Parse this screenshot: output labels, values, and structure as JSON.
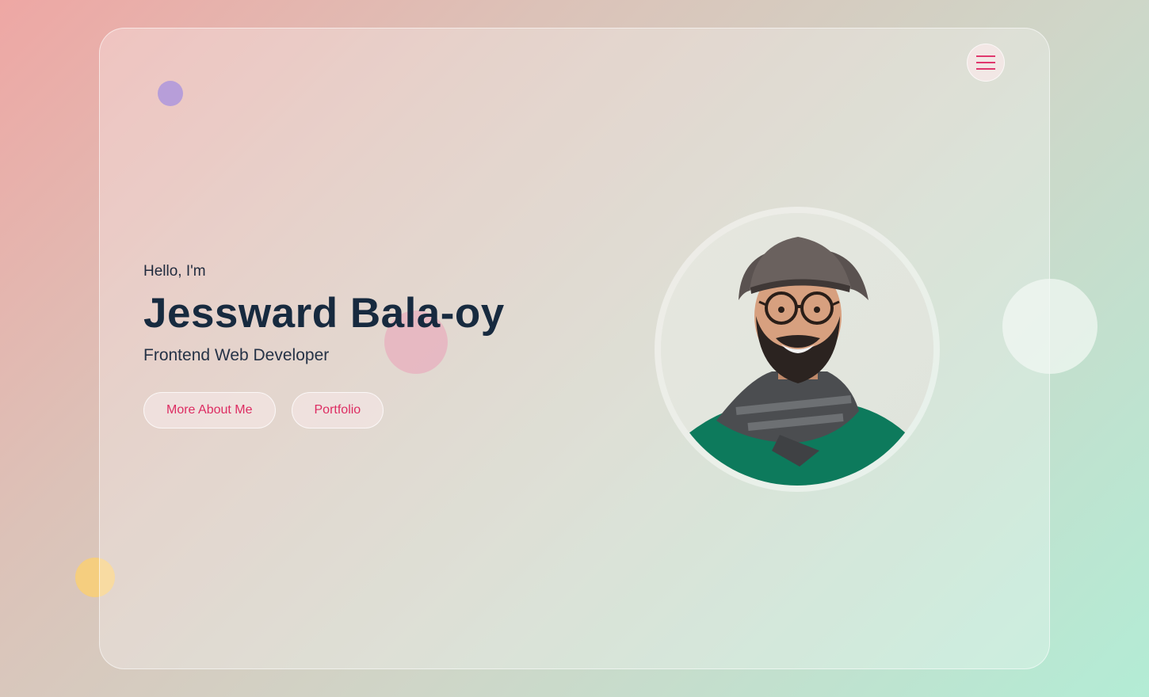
{
  "header": {
    "menu_icon": "hamburger-menu-icon",
    "accent_color": "#e0386e"
  },
  "hero": {
    "greeting": "Hello, I'm",
    "name": "Jessward Bala-oy",
    "role": "Frontend Web Developer",
    "primary_button": "More About Me",
    "secondary_button": "Portfolio"
  },
  "profile": {
    "image": "profile-photo"
  },
  "colors": {
    "accent": "#dd2c62",
    "heading": "#172a3f"
  }
}
